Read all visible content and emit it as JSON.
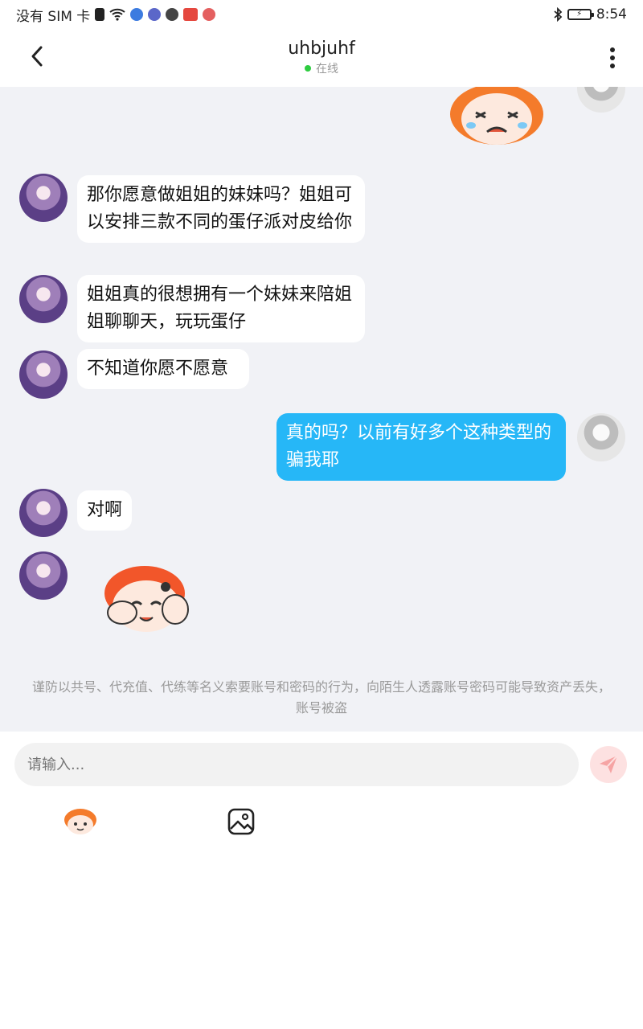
{
  "status_bar": {
    "carrier": "没有 SIM 卡",
    "time": "8:54"
  },
  "header": {
    "title": "uhbjuhf",
    "status": "在线",
    "status_color": "#2ecc40"
  },
  "messages": [
    {
      "side": "left",
      "text": "那你愿意做姐姐的妹妹吗？姐姐可以安排三款不同的蛋仔派对皮给你"
    },
    {
      "side": "left",
      "text": "姐姐真的很想拥有一个妹妹来陪姐姐聊聊天，玩玩蛋仔"
    },
    {
      "side": "left",
      "text": "不知道你愿不愿意"
    },
    {
      "side": "right",
      "text": "真的吗？以前有好多个这种类型的骗我耶"
    },
    {
      "side": "left",
      "text": "对啊"
    }
  ],
  "notice": "谨防以共号、代充值、代练等名义索要账号和密码的行为，向陌生人透露账号密码可能导致资产丢失，账号被盗",
  "input": {
    "placeholder": "请输入..."
  },
  "icons": {
    "back": "back-arrow-icon",
    "more": "more-vertical-icon",
    "send": "send-icon",
    "emoji": "emoji-icon",
    "image": "image-icon"
  },
  "colors": {
    "bubble_right": "#26b7f7",
    "chat_bg": "#f1f2f6"
  }
}
